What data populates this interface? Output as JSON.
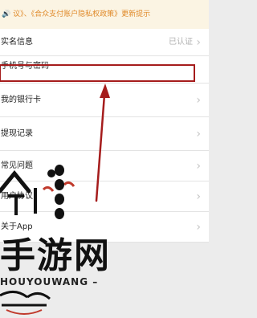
{
  "notice": {
    "text": "🔊 议》、《合众支付账户隐私权政策》更新提示"
  },
  "list": {
    "items": [
      {
        "label": "实名信息",
        "value": "已认证",
        "chevron": "›"
      },
      {
        "label": "手机号与密码",
        "value": "",
        "chevron": ""
      },
      {
        "label": "我的银行卡",
        "value": "",
        "chevron": "›"
      },
      {
        "label": "提现记录",
        "value": "",
        "chevron": "›"
      },
      {
        "label": "常见问题",
        "value": "",
        "chevron": "›"
      },
      {
        "label": "用户协议",
        "value": "",
        "chevron": "›"
      },
      {
        "label": "关于App",
        "value": "",
        "chevron": "›"
      }
    ]
  },
  "annotation": {
    "highlight_color": "#a51c1c"
  },
  "watermark": {
    "big_text": "手游网",
    "small_text": "HOUYOUWANG –"
  }
}
